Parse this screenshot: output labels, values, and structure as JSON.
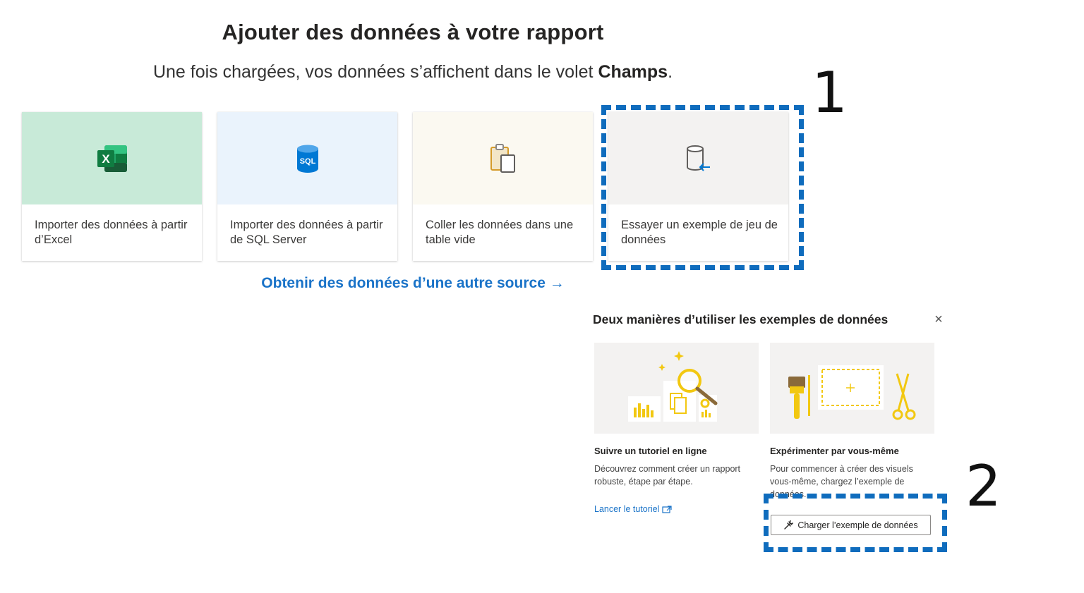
{
  "page": {
    "title": "Ajouter des données à votre rapport",
    "subtitle_prefix": "Une fois chargées, vos données s’affichent dans le volet",
    "subtitle_bold": "Champs",
    "subtitle_suffix": "."
  },
  "cards": [
    {
      "label_line1": "Importer des données à partir",
      "label_line2": "d’Excel",
      "icon": "excel-icon"
    },
    {
      "label_line1": "Importer des données à partir",
      "label_line2": "de SQL Server",
      "icon": "sql-server-icon"
    },
    {
      "label_line1": "Coller les données dans une",
      "label_line2": "table vide",
      "icon": "clipboard-icon"
    },
    {
      "label_line1": "Essayer un exemple de jeu de",
      "label_line2": "données",
      "icon": "sample-data-icon"
    }
  ],
  "annotations": {
    "step1": "1",
    "step2": "2",
    "color": "#0f6cbd"
  },
  "other_source_link": "Obtenir des données d’une autre source →",
  "panel": {
    "title": "Deux manières d’utiliser les exemples de données",
    "close_glyph": "×",
    "option1": {
      "heading": "Suivre un tutoriel en ligne",
      "text_line1": "Découvrez comment créer un rapport",
      "text_line2": "robuste, étape par étape.",
      "link": "Lancer le tutoriel"
    },
    "option2": {
      "heading": "Expérimenter par vous-même",
      "text_line1": "Pour commencer à créer des visuels",
      "text_line2": "vous-même, chargez l’exemple de",
      "text_line3": "données.",
      "button": "Charger l’exemple de données"
    }
  }
}
